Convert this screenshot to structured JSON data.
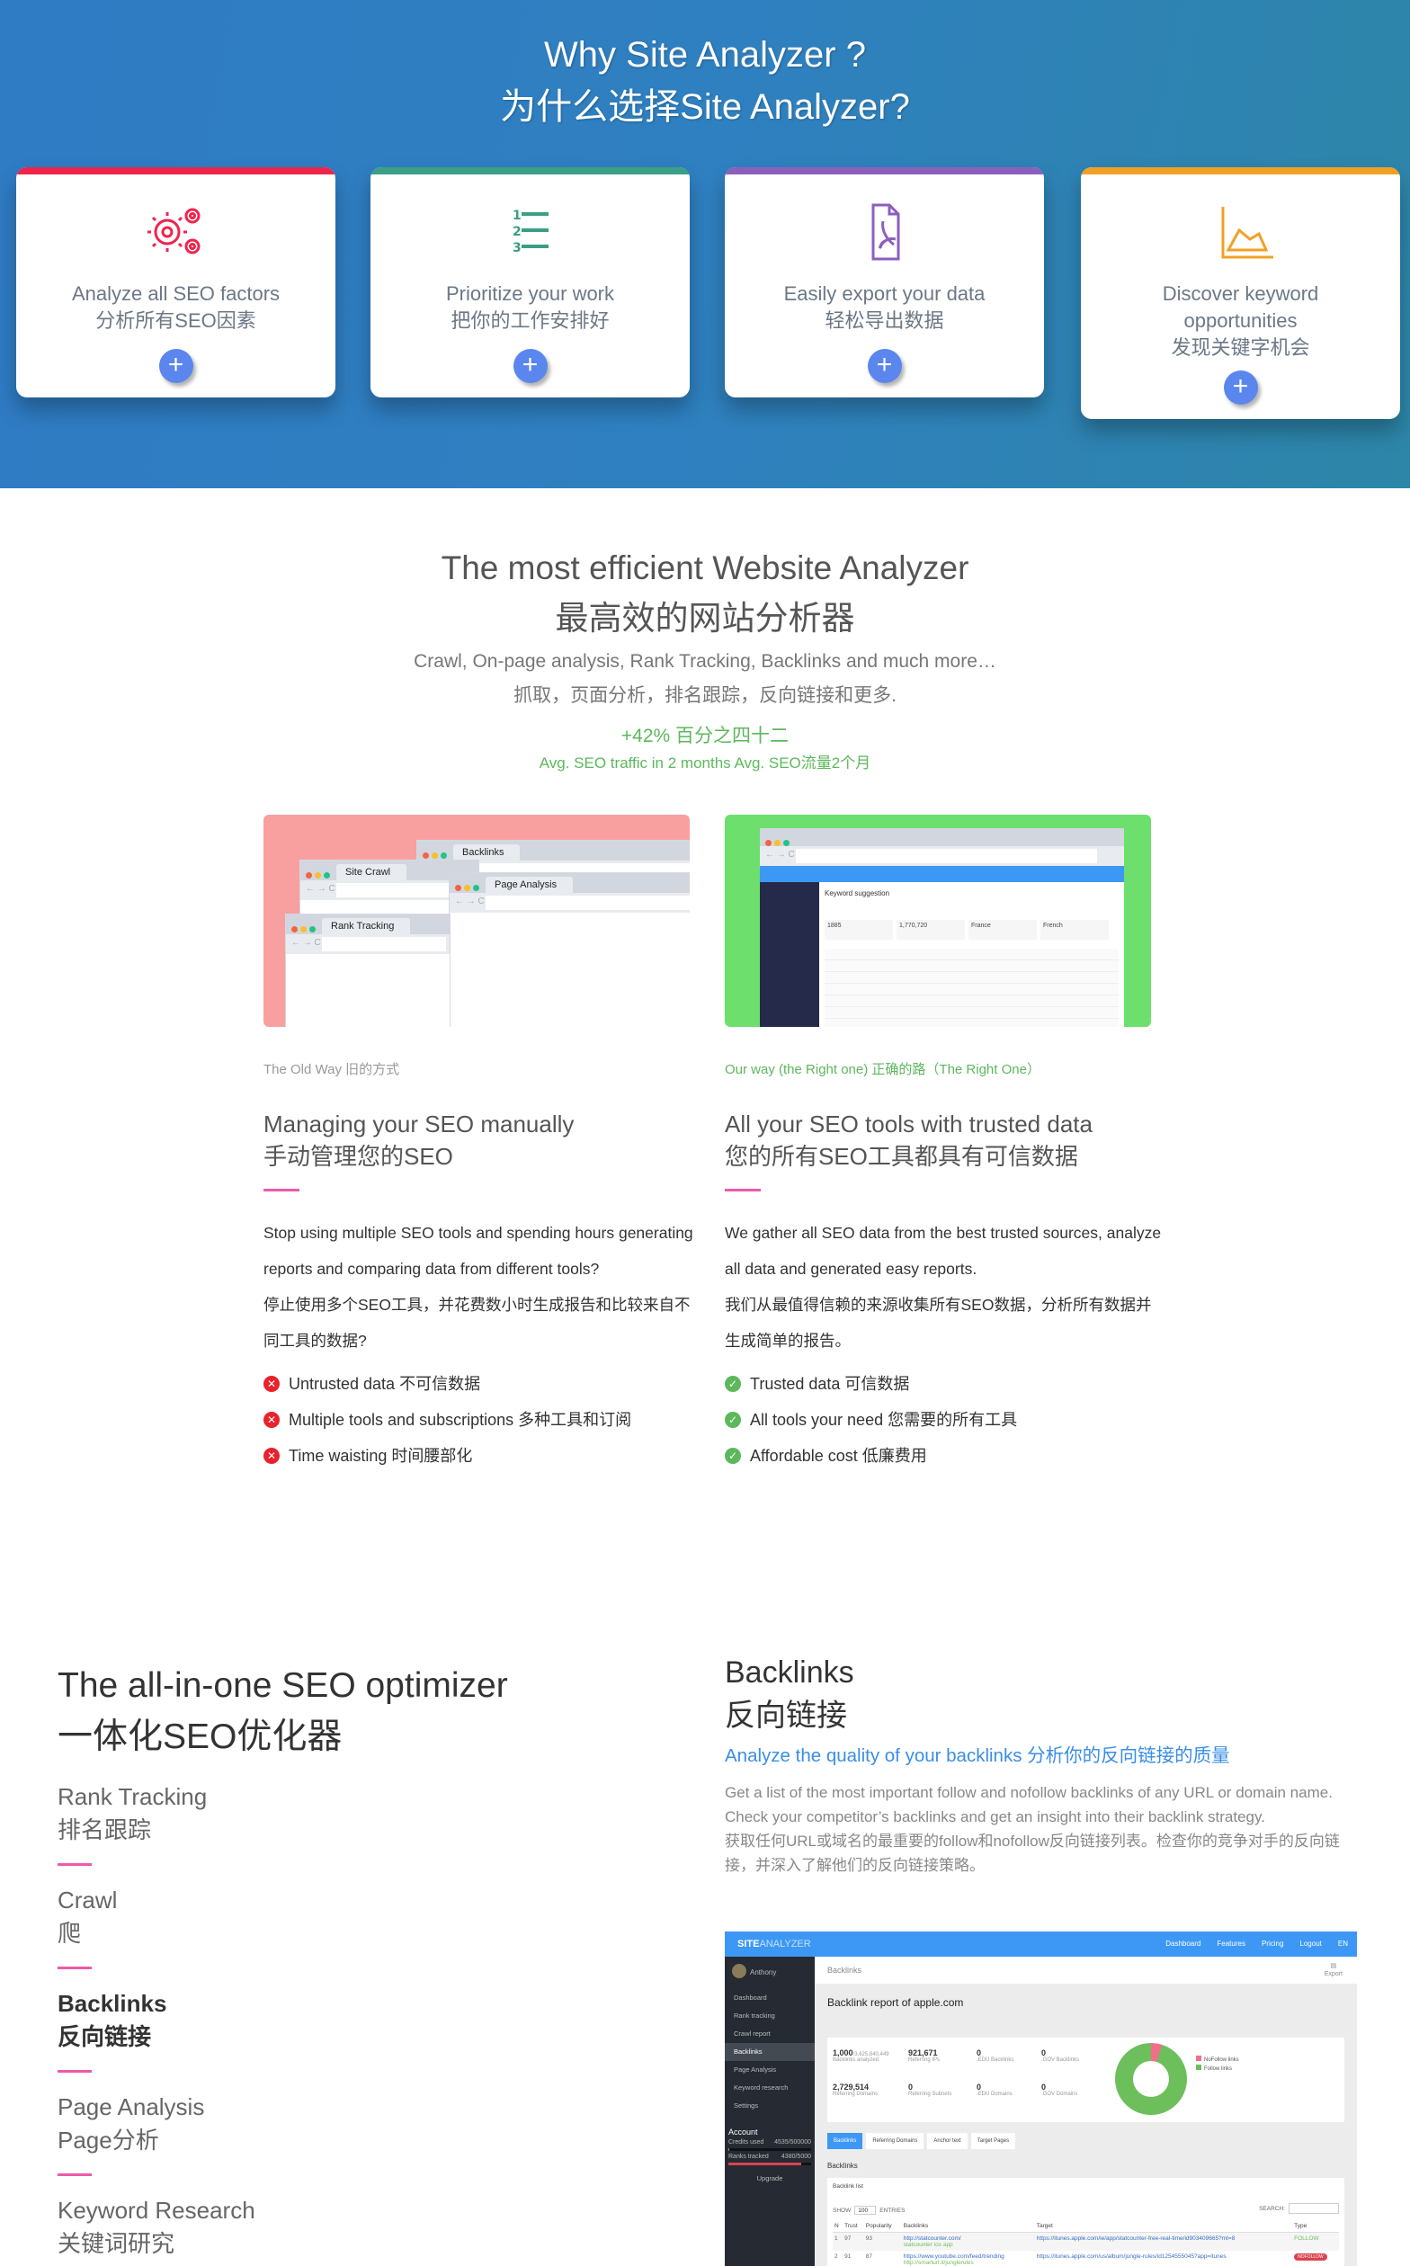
{
  "hero": {
    "title_en": "Why Site Analyzer ?",
    "title_cn": "为什么选择Site Analyzer?",
    "cards": [
      {
        "title_en": "Analyze all SEO factors",
        "title_cn": "分析所有SEO因素",
        "icon": "gears-icon",
        "accent": "#f0244b",
        "button": "+"
      },
      {
        "title_en": "Prioritize your work",
        "title_cn": "把你的工作安排好",
        "icon": "numbered-list-icon",
        "accent": "#3a9f84",
        "button": "+"
      },
      {
        "title_en": "Easily export your data",
        "title_cn": "轻松导出数据",
        "icon": "pdf-file-icon",
        "accent": "#8c5fbf",
        "button": "+"
      },
      {
        "title_en": "Discover keyword opportunities",
        "title_cn": "发现关键字机会",
        "icon": "area-chart-icon",
        "accent": "#f2a025",
        "button": "+"
      }
    ]
  },
  "intro": {
    "title_en": "The most efficient Website Analyzer",
    "title_cn": "最高效的网站分析器",
    "sub_en": "Crawl, On-page analysis, Rank Tracking, Backlinks and much more…",
    "sub_cn": "抓取，页面分析，排名跟踪，反向链接和更多.",
    "stat": "+42% 百分之四十二",
    "stat_caption": "Avg. SEO traffic in 2 months Avg. SEO流量2个月"
  },
  "old_way": {
    "windows": [
      "Backlinks",
      "Site Crawl",
      "Page Analysis",
      "Rank Tracking"
    ],
    "kicker": "The Old Way 旧的方式",
    "title_en": "Managing your SEO manually",
    "title_cn": "手动管理您的SEO",
    "body_en": "Stop using multiple SEO tools and spending hours generating reports and comparing data from different tools?",
    "body_cn": "停止使用多个SEO工具，并花费数小时生成报告和比较来自不同工具的数据?",
    "items": [
      "Untrusted data  不可信数据",
      "Multiple tools and subscriptions  多种工具和订阅",
      "Time waisting  时间腰部化"
    ]
  },
  "our_way": {
    "kicker": "Our way (the Right one) 正确的路（The Right One）",
    "title_en": "All your SEO tools with trusted data",
    "title_cn": "您的所有SEO工具都具有可信数据",
    "body_en": "We gather all SEO data from the best trusted sources, analyze all data and generated easy reports.",
    "body_cn": "我们从最值得信赖的来源收集所有SEO数据，分析所有数据并生成简单的报告。",
    "items": [
      "Trusted data  可信数据",
      "All tools your need  您需要的所有工具",
      "Affordable cost  低廉费用"
    ],
    "screenshot": {
      "title": "Keyword suggestion",
      "stats": [
        "1885",
        "1,770,720",
        "France",
        "French"
      ]
    }
  },
  "optimizer": {
    "title_en": "The all-in-one SEO optimizer",
    "title_cn": "一体化SEO优化器",
    "items": [
      {
        "en": "Rank Tracking",
        "cn": "排名跟踪",
        "active": false
      },
      {
        "en": "Crawl",
        "cn": "爬",
        "active": false
      },
      {
        "en": "Backlinks",
        "cn": "反向链接",
        "active": true
      },
      {
        "en": "Page Analysis",
        "cn": "Page分析",
        "active": false
      },
      {
        "en": "Keyword Research",
        "cn": "关键词研究",
        "active": false
      }
    ]
  },
  "backlinks": {
    "title_en": "Backlinks",
    "title_cn": "反向链接",
    "link": "Analyze the quality of your backlinks 分析你的反向链接的质量",
    "desc_en": "Get a list of the most important follow and nofollow backlinks of any URL or domain name. Check your competitor’s backlinks and get an insight into their backlink strategy.",
    "desc_cn": "获取任何URL或域名的最重要的follow和nofollow反向链接列表。检查你的竞争对手的反向链接，并深入了解他们的反向链接策略。"
  },
  "app": {
    "logo_bold": "SITE",
    "logo_light": "ANALYZER",
    "topnav": [
      "Dashboard",
      "Features",
      "Pricing",
      "Logout",
      "EN"
    ],
    "user": "Anthony",
    "side": [
      "Dashboard",
      "Rank tracking",
      "Crawl report",
      "Backlinks",
      "Page Analysis",
      "Keyword research",
      "Settings"
    ],
    "account": "Account",
    "credits_label": "Credits used",
    "credits_value": "4535/500000",
    "credits_fraction": 0.009,
    "ranks_label": "Ranks tracked",
    "ranks_value": "4380/5000",
    "ranks_fraction": 0.876,
    "upgrade": "Upgrade",
    "crumb": "Backlinks",
    "export": "Export",
    "report_title": "Backlink report of apple.com",
    "stats": [
      {
        "value": "1,000",
        "extra": "/3,625,840,449",
        "label": "Backlinks analyzed"
      },
      {
        "value": "921,671",
        "extra": "",
        "label": "Referring IPs"
      },
      {
        "value": "0",
        "extra": "",
        "label": ".EDU Backlinks"
      },
      {
        "value": "0",
        "extra": "",
        "label": ".GOV Backlinks"
      },
      {
        "value": "2,729,514",
        "extra": "",
        "label": "Referring Domains"
      },
      {
        "value": "0",
        "extra": "",
        "label": "Referring Subnets"
      },
      {
        "value": "0",
        "extra": "",
        "label": ".EDU Domains"
      },
      {
        "value": "0",
        "extra": "",
        "label": ".GOV Domains"
      }
    ],
    "legend": [
      "NoFollow links",
      "Follow links"
    ],
    "tabs": [
      "Backlinks",
      "Referring Domains",
      "Anchor text",
      "Target Pages"
    ],
    "section": "Backlinks",
    "list_title": "Backlink list",
    "show": "SHOW",
    "show_value": "100",
    "entries": "ENTRIES",
    "search": "SEARCH:",
    "columns": [
      "N",
      "Trust",
      "Popularity",
      "Backlinks",
      "Target",
      "Type"
    ],
    "rows": [
      {
        "n": "1",
        "trust": "97",
        "pop": "93",
        "link": "http://statcounter.com/",
        "anchor": "statcounter ios app",
        "target": "https://itunes.apple.com/ie/app/statcounter-free-real-time/id903409665?mt=8",
        "type": "FOLLOW"
      },
      {
        "n": "2",
        "trust": "91",
        "pop": "87",
        "link": "https://www.youtube.com/feed/trending",
        "anchor": "http://smarturl.it/junglerules",
        "target": "https://itunes.apple.com/us/album/jungle-rules/id1254555045?app=itunes",
        "type": "NOFOLLOW"
      }
    ]
  }
}
